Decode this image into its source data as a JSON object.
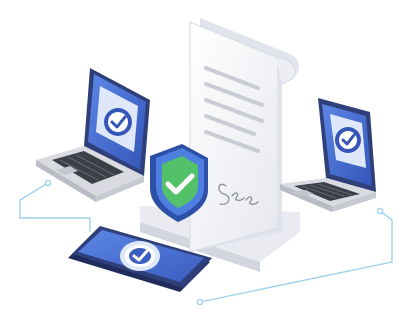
{
  "illustration": {
    "subject": "secure-document-signing",
    "icons": {
      "laptop_left": "laptop-check-icon",
      "laptop_right": "laptop-check-icon",
      "phone": "smartphone-check-icon",
      "document": "signed-scroll-document-icon",
      "shield": "shield-check-icon",
      "signature": "handwritten-signature-icon"
    },
    "colors": {
      "screen_blue": "#4a74d6",
      "screen_dark": "#2d4fa8",
      "bezel": "#2f3f7a",
      "shield_blue": "#4d7fe0",
      "check_green": "#52c16a",
      "connector_line": "#9fd1ee",
      "paper": "#f4f5f8",
      "paper_shade": "#dfe2ea",
      "text_lines": "#c9ccd4",
      "keyboard": "#3c3f47",
      "laptop_body": "#d9dbe0"
    }
  }
}
